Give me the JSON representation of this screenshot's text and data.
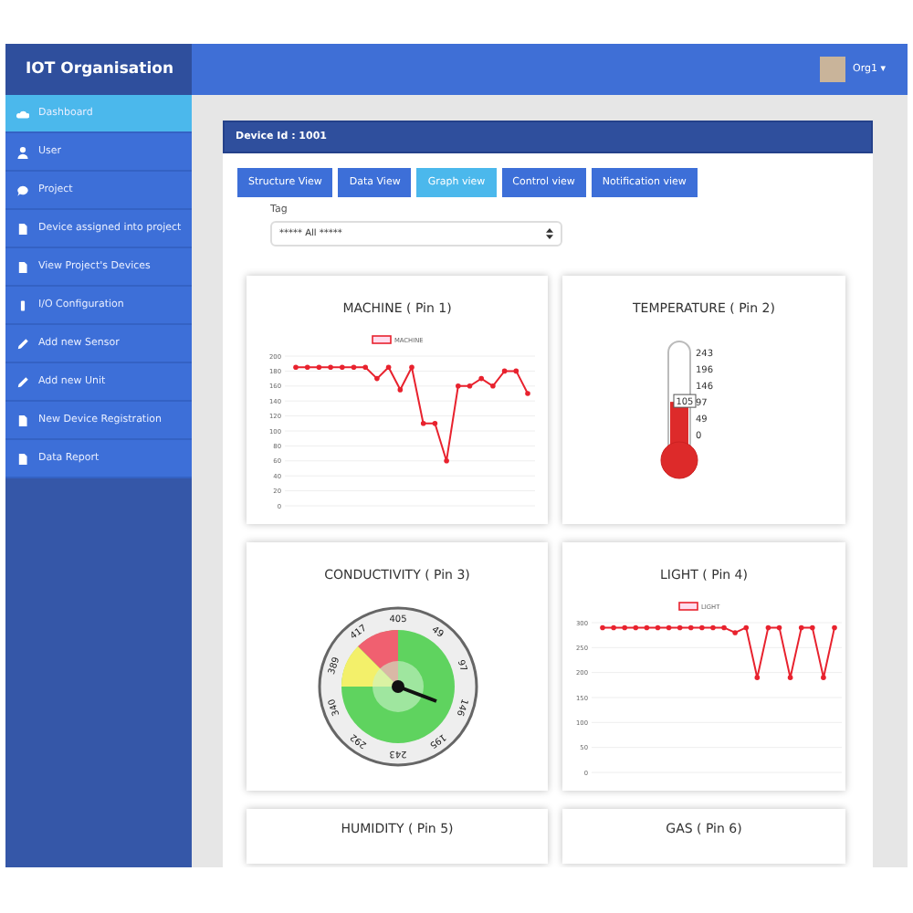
{
  "brand": "IOT Organisation",
  "user": {
    "name": "Org1 ▾"
  },
  "sidebar": {
    "items": [
      {
        "label": "Dashboard",
        "selected": true
      },
      {
        "label": "User",
        "selected": false
      },
      {
        "label": "Project",
        "selected": false
      },
      {
        "label": "Device assigned into project",
        "selected": false
      },
      {
        "label": "View Project's Devices",
        "selected": false
      },
      {
        "label": "I/O Configuration",
        "selected": false
      },
      {
        "label": "Add new Sensor",
        "selected": false
      },
      {
        "label": "Add new Unit",
        "selected": false
      },
      {
        "label": "New Device Registration",
        "selected": false
      },
      {
        "label": "Data Report",
        "selected": false
      }
    ]
  },
  "device_header": "Device Id : 1001",
  "tabs": [
    {
      "label": "Structure View",
      "selected": false
    },
    {
      "label": "Data View",
      "selected": false
    },
    {
      "label": "Graph view",
      "selected": true
    },
    {
      "label": "Control view",
      "selected": false
    },
    {
      "label": "Notification view",
      "selected": false
    }
  ],
  "tag": {
    "label": "Tag",
    "value": "***** All *****"
  },
  "widgets": [
    {
      "kind": "line",
      "title": "MACHINE ( Pin 1)",
      "chart_data": {
        "type": "line",
        "grid": true,
        "series": [
          {
            "name": "MACHINE",
            "color": "#e8222e",
            "values": [
              185,
              185,
              185,
              185,
              185,
              185,
              185,
              170,
              185,
              155,
              185,
              110,
              110,
              60,
              160,
              160,
              170,
              160,
              180,
              180,
              150
            ]
          }
        ],
        "ylim": [
          0,
          200
        ],
        "yticks": [
          0,
          20,
          40,
          60,
          80,
          100,
          120,
          140,
          160,
          180,
          200
        ]
      }
    },
    {
      "kind": "thermometer",
      "title": "TEMPERATURE ( Pin 2)",
      "ticks": [
        "243",
        "196",
        "146",
        "97",
        "49",
        "0"
      ],
      "reading": "105",
      "level": 0.43
    },
    {
      "kind": "gauge",
      "title": "CONDUCTIVITY ( Pin 3)",
      "ticks": [
        "405",
        "49",
        "97",
        "146",
        "195",
        "243",
        "292",
        "340",
        "389",
        "417"
      ]
    },
    {
      "kind": "line",
      "title": "LIGHT ( Pin 4)",
      "chart_data": {
        "type": "line",
        "grid": true,
        "series": [
          {
            "name": "LIGHT",
            "color": "#e8222e",
            "values": [
              290,
              290,
              290,
              290,
              290,
              290,
              290,
              290,
              290,
              290,
              290,
              290,
              280,
              290,
              190,
              290,
              290,
              190,
              290,
              290,
              190,
              290
            ]
          }
        ],
        "ylim": [
          0,
          300
        ],
        "yticks": [
          0,
          50,
          100,
          150,
          200,
          250,
          300
        ]
      }
    },
    {
      "kind": "partial",
      "title": "HUMIDITY ( Pin 5)"
    },
    {
      "kind": "partial",
      "title": "GAS ( Pin 6)"
    }
  ]
}
